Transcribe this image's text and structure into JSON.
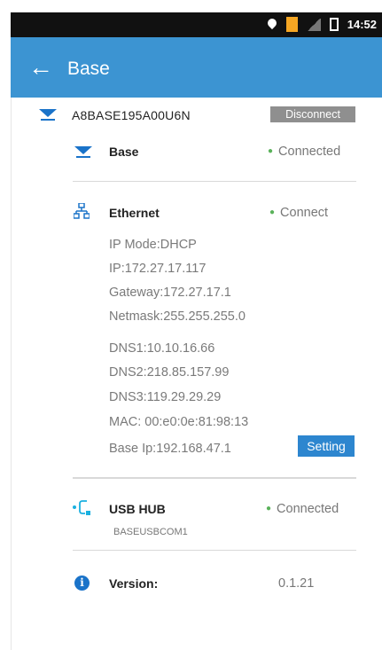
{
  "status_bar": {
    "time": "14:52"
  },
  "app_bar": {
    "title": "Base",
    "back_icon": "arrow-left-icon"
  },
  "device": {
    "name": "A8BASE195A00U6N",
    "disconnect_label": "Disconnect"
  },
  "base_link": {
    "label": "Base",
    "status": "Connected"
  },
  "ethernet": {
    "label": "Ethernet",
    "status": "Connect",
    "details": [
      "IP Mode:DHCP",
      "IP:172.27.17.117",
      "Gateway:172.27.17.1",
      "Netmask:255.255.255.0",
      "DNS1:10.10.16.66",
      "DNS2:218.85.157.99",
      "DNS3:119.29.29.29",
      "MAC: 00:e0:0e:81:98:13",
      "Base Ip:192.168.47.1"
    ],
    "setting_label": "Setting"
  },
  "usb": {
    "label": "USB HUB",
    "sublabel": "BASEUSBCOM1",
    "status": "Connected"
  },
  "version": {
    "label": "Version:",
    "value": "0.1.21"
  },
  "colors": {
    "app_bar": "#3c94d2",
    "accent": "#1a73c9",
    "status_dot": "#5ab25a",
    "button_grey": "#8f8f8f"
  }
}
